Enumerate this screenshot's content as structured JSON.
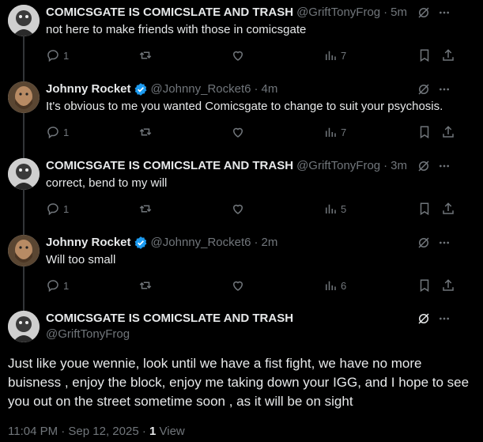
{
  "replies": [
    {
      "name": "COMICSGATE IS COMICSLATE AND TRASH",
      "handle": "@GriftTonyFrog",
      "sep": "·",
      "time": "5m",
      "text": "not here to make friends with those in comicsgate",
      "replies_count": "1",
      "views": "7",
      "verified": false,
      "avatar": "frog-avatar"
    },
    {
      "name": "Johnny Rocket",
      "handle": "@Johnny_Rocket6",
      "sep": "·",
      "time": "4m",
      "text": "It's obvious to me you wanted Comicsgate to change to suit your psychosis.",
      "replies_count": "1",
      "views": "7",
      "verified": true,
      "avatar": "bearded-man-avatar"
    },
    {
      "name": "COMICSGATE IS COMICSLATE AND TRASH",
      "handle": "@GriftTonyFrog",
      "sep": "·",
      "time": "3m",
      "text": "correct, bend to my will",
      "replies_count": "1",
      "views": "5",
      "verified": false,
      "avatar": "frog-avatar"
    },
    {
      "name": "Johnny Rocket",
      "handle": "@Johnny_Rocket6",
      "sep": "·",
      "time": "2m",
      "text": "Will too small",
      "replies_count": "1",
      "views": "6",
      "verified": true,
      "avatar": "bearded-man-avatar"
    }
  ],
  "main_post": {
    "name": "COMICSGATE IS COMICSLATE AND TRASH",
    "handle": "@GriftTonyFrog",
    "text": "Just like youe wennie, look until we have a fist fight, we have no more buisness , enjoy the block, enjoy me taking down your IGG, and I hope to see you out on the street sometime soon , as it will be on sight",
    "timestamp": "11:04 PM · Sep 12, 2025 · ",
    "views_count": "1",
    "views_label": " View"
  },
  "colors": {
    "background": "#000000",
    "text": "#e7e9ea",
    "muted": "#71767b",
    "verified": "#1d9bf0",
    "thread_line": "#333639"
  }
}
